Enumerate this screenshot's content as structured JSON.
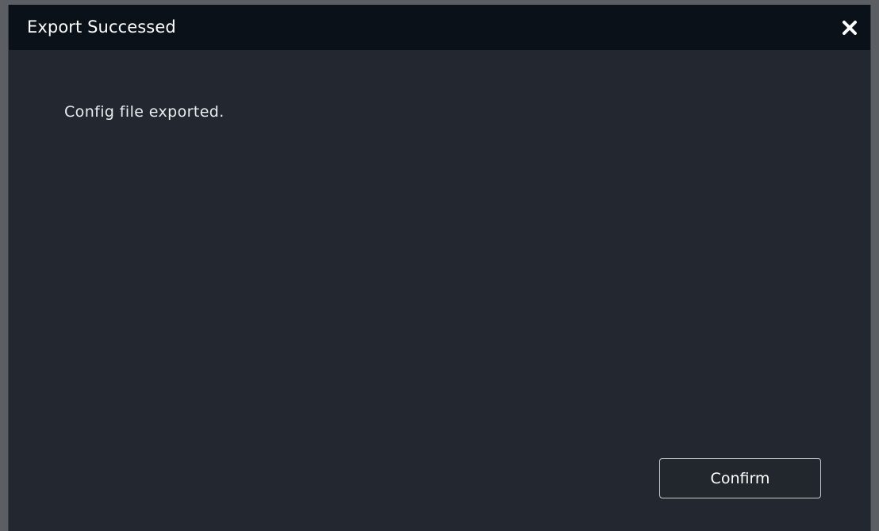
{
  "dialog": {
    "title": "Export Successed",
    "message": "Config file exported.",
    "confirm_label": "Confirm",
    "close_icon": "close-icon"
  },
  "colors": {
    "titlebar_bg": "#0b1118",
    "body_bg": "#232830",
    "text": "#ffffff",
    "button_border": "#c9ccd0"
  }
}
